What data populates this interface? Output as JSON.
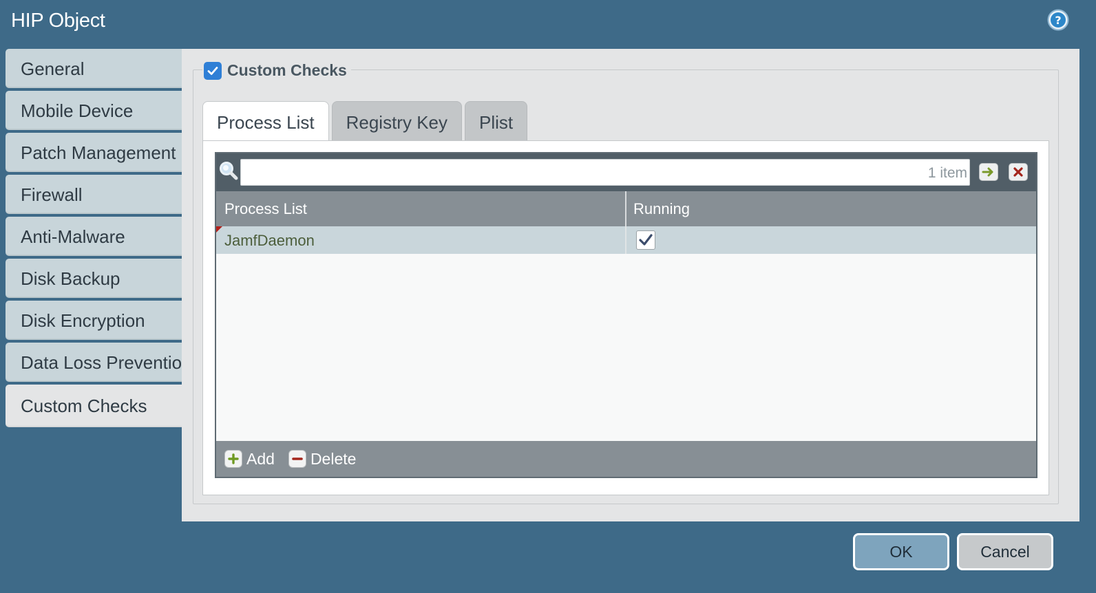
{
  "window": {
    "title": "HIP Object",
    "help_icon": "help-circle-icon"
  },
  "sidebar": {
    "items": [
      {
        "label": "General",
        "active": false
      },
      {
        "label": "Mobile Device",
        "active": false
      },
      {
        "label": "Patch Management",
        "active": false
      },
      {
        "label": "Firewall",
        "active": false
      },
      {
        "label": "Anti-Malware",
        "active": false
      },
      {
        "label": "Disk Backup",
        "active": false
      },
      {
        "label": "Disk Encryption",
        "active": false
      },
      {
        "label": "Data Loss Prevention",
        "active": false
      },
      {
        "label": "Custom Checks",
        "active": true
      }
    ]
  },
  "section": {
    "label": "Custom Checks",
    "checked": true
  },
  "tabs": [
    {
      "label": "Process List",
      "active": true
    },
    {
      "label": "Registry Key",
      "active": false
    },
    {
      "label": "Plist",
      "active": false
    }
  ],
  "grid": {
    "search": {
      "value": "",
      "placeholder": ""
    },
    "count_text": "1 item",
    "apply_filter_icon": "arrow-right-icon",
    "clear_filter_icon": "close-x-icon",
    "columns": [
      "Process List",
      "Running"
    ],
    "rows": [
      {
        "process": "JamfDaemon",
        "running": true
      }
    ],
    "footer": {
      "add_label": "Add",
      "delete_label": "Delete"
    }
  },
  "buttons": {
    "ok": "OK",
    "cancel": "Cancel"
  },
  "colors": {
    "background": "#3e6a88",
    "panel": "#e4e5e6",
    "checkbox_accent": "#2f7fd6",
    "row_selected": "#c9d6db",
    "ok_button": "#7ea4bd"
  }
}
